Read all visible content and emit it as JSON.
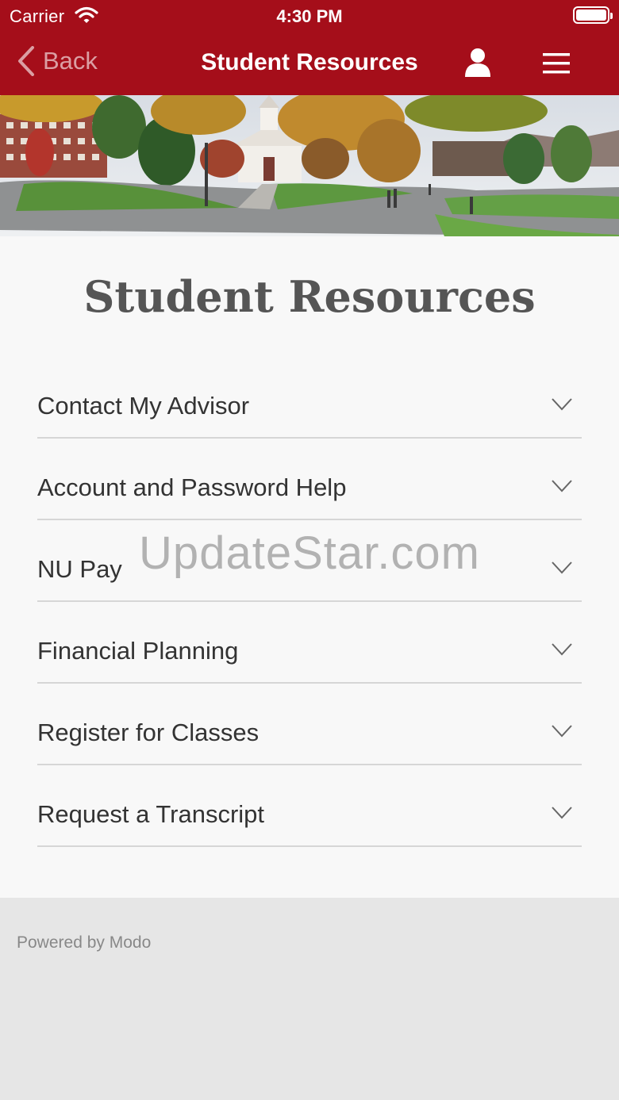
{
  "status_bar": {
    "carrier": "Carrier",
    "time": "4:30 PM"
  },
  "nav": {
    "back_label": "Back",
    "title": "Student Resources"
  },
  "main": {
    "title": "Student Resources",
    "items": [
      {
        "label": "Contact My Advisor"
      },
      {
        "label": "Account and Password Help"
      },
      {
        "label": "NU Pay"
      },
      {
        "label": "Financial Planning"
      },
      {
        "label": "Register for Classes"
      },
      {
        "label": "Request a Transcript"
      }
    ]
  },
  "watermark": "UpdateStar.com",
  "footer": {
    "powered_by": "Powered by Modo"
  },
  "colors": {
    "brand": "#a50e1a",
    "background": "#f8f8f8",
    "footer": "#e6e6e6"
  },
  "icons": [
    "wifi-icon",
    "battery-icon",
    "back-chevron-icon",
    "user-icon",
    "menu-icon",
    "chevron-down-icon"
  ]
}
